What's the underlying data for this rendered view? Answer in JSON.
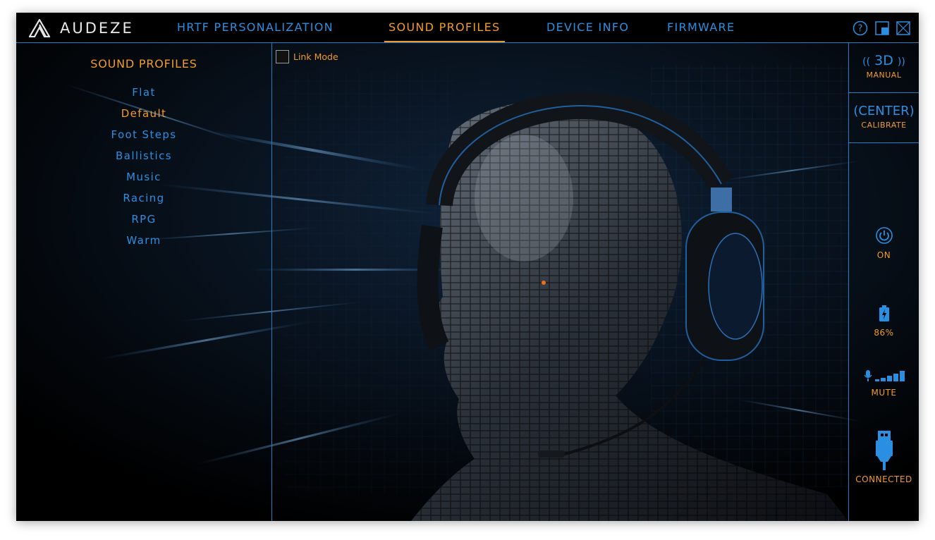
{
  "app": {
    "brand": "AUDEZE"
  },
  "nav": {
    "tabs": [
      {
        "label": "HRTF PERSONALIZATION",
        "active": false
      },
      {
        "label": "SOUND PROFILES",
        "active": true
      },
      {
        "label": "DEVICE INFO",
        "active": false
      },
      {
        "label": "FIRMWARE",
        "active": false
      }
    ],
    "icons": [
      "help-icon",
      "minimize-icon",
      "close-icon"
    ]
  },
  "sound_profiles": {
    "title": "SOUND PROFILES",
    "items": [
      {
        "label": "Flat",
        "selected": false
      },
      {
        "label": "Default",
        "selected": true
      },
      {
        "label": "Foot Steps",
        "selected": false
      },
      {
        "label": "Ballistics",
        "selected": false
      },
      {
        "label": "Music",
        "selected": false
      },
      {
        "label": "Racing",
        "selected": false
      },
      {
        "label": "RPG",
        "selected": false
      },
      {
        "label": "Warm",
        "selected": false
      }
    ]
  },
  "link_mode": {
    "label": "Link Mode",
    "checked": false
  },
  "side": {
    "mode_3d": {
      "value": "3D",
      "label": "MANUAL"
    },
    "center": {
      "value": "CENTER",
      "label": "CALIBRATE"
    },
    "power": {
      "icon": "power-icon",
      "label": "ON"
    },
    "battery": {
      "icon": "battery-charging-icon",
      "label": "86%"
    },
    "mic": {
      "icon": "mic-level-icon",
      "label": "MUTE"
    },
    "usb": {
      "icon": "usb-icon",
      "label": "CONNECTED"
    }
  },
  "colors": {
    "accent_orange": "#f29a26",
    "accent_blue": "#2a8fe0",
    "border_blue": "#1e7fc2",
    "background": "#000000"
  }
}
